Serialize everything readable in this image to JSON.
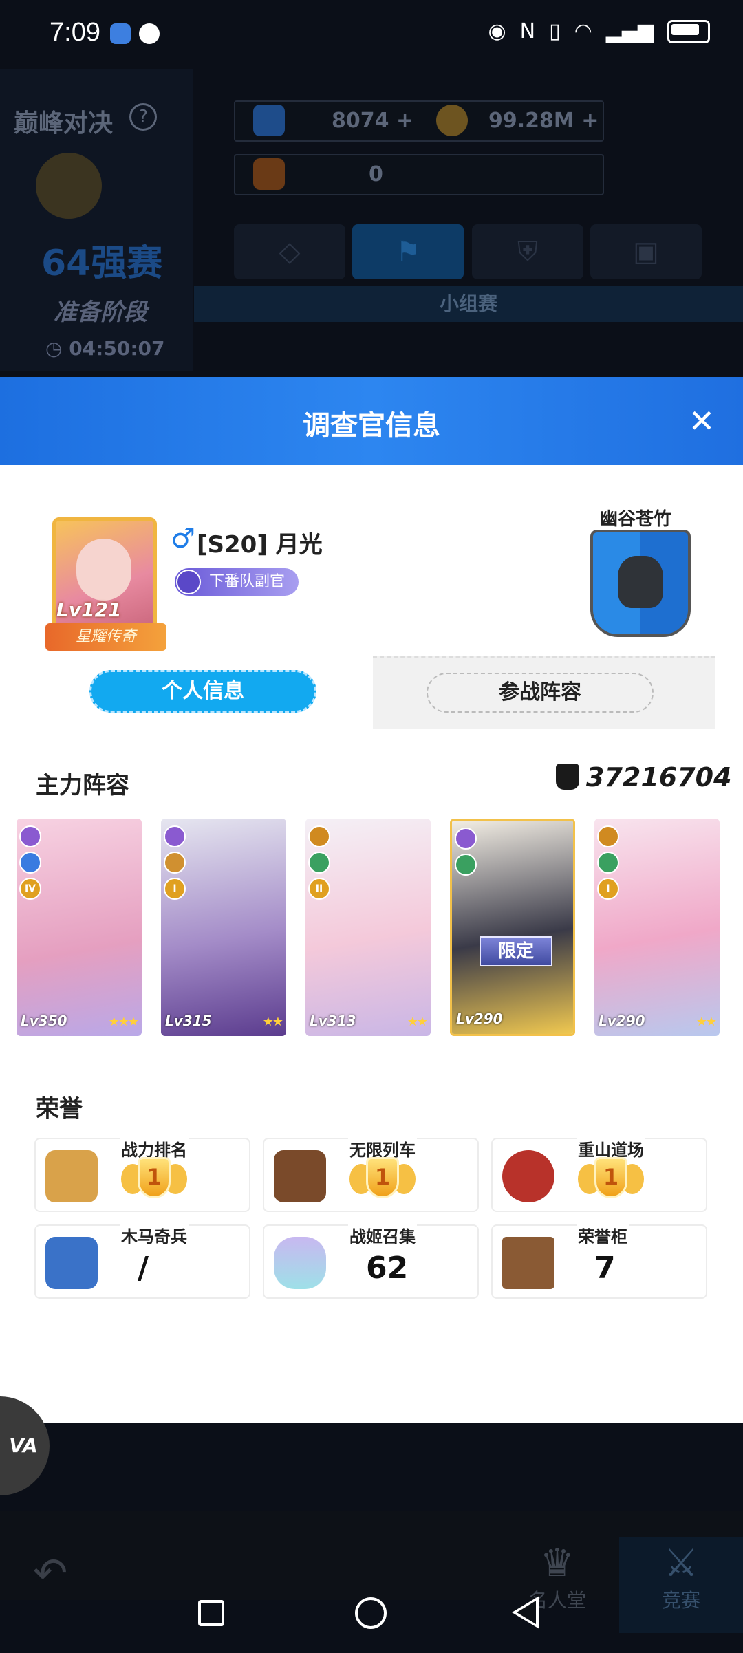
{
  "status_bar": {
    "time": "7:09"
  },
  "background": {
    "mode_title": "巅峰对决",
    "bracket": "64强赛",
    "stage": "准备阶段",
    "timer": "04:50:07",
    "diamonds": "8074",
    "gold": "99.28M",
    "third_resource": "0",
    "group_tab": "小组赛"
  },
  "modal": {
    "title": "调查官信息",
    "player": {
      "gender": "♂",
      "name": "[S20] 月光",
      "level": "Lv121",
      "rank_title": "下番队副官",
      "frame_title": "星耀传奇"
    },
    "guild": {
      "name": "幽谷苍竹"
    },
    "tabs": {
      "personal": "个人信息",
      "lineup": "参战阵容"
    },
    "lineup": {
      "title": "主力阵容",
      "power": "37216704",
      "cards": [
        {
          "level": "Lv350",
          "stars": "★★★",
          "tier": "IV",
          "color": "#f2b7d0"
        },
        {
          "level": "Lv315",
          "stars": "★★",
          "tier": "I",
          "color": "#b6a3d0"
        },
        {
          "level": "Lv313",
          "stars": "★★",
          "tier": "II",
          "color": "#f6d6e4"
        },
        {
          "level": "Lv290",
          "stars": "",
          "tier": "",
          "color": "#f4e2b0",
          "tag": "限定"
        },
        {
          "level": "Lv290",
          "stars": "★★",
          "tier": "I",
          "color": "#f5c2d8"
        }
      ]
    },
    "honor": {
      "title": "荣誉",
      "items": [
        {
          "label": "战力排名",
          "value": "1",
          "type": "medal",
          "icon": "fist-icon"
        },
        {
          "label": "无限列车",
          "value": "1",
          "type": "medal",
          "icon": "train-icon"
        },
        {
          "label": "重山道场",
          "value": "1",
          "type": "medal",
          "icon": "drum-icon"
        },
        {
          "label": "木马奇兵",
          "value": "/",
          "type": "text",
          "icon": "knight-icon"
        },
        {
          "label": "战姬召集",
          "value": "62",
          "type": "text",
          "icon": "silhouette-icon"
        },
        {
          "label": "荣誉柜",
          "value": "7",
          "type": "text",
          "icon": "cabinet-icon"
        }
      ]
    }
  },
  "floating": {
    "label": "VA"
  },
  "bottom_nav": {
    "hall": "名人堂",
    "compete": "竞赛"
  },
  "colors": {
    "accent": "#1d7ce8",
    "pill": "#12a9f0"
  }
}
